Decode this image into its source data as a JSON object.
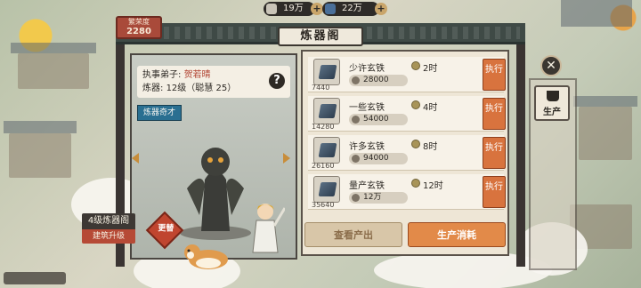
{
  "resources": [
    {
      "value": "19万",
      "icon": "silver-ingot-icon",
      "color": "#c9c4b8"
    },
    {
      "value": "22万",
      "icon": "ore-icon",
      "color": "#4a6f99"
    }
  ],
  "header": {
    "title": "炼器阁",
    "badge_label": "繁荣度",
    "badge_value": "2280"
  },
  "info": {
    "disciple_label": "执事弟子:",
    "disciple_name": "贺若晴",
    "forge_label": "炼器:",
    "forge_value": "12级（聪慧 25）"
  },
  "tag_label": "炼器奇才",
  "change_label": "更替",
  "building": {
    "level_label": "4级炼器阁",
    "upgrade_label": "建筑升级"
  },
  "items": [
    {
      "name": "少许玄铁",
      "qty": "7440",
      "cost": "28000",
      "time": "2时",
      "action": "执行"
    },
    {
      "name": "一些玄铁",
      "qty": "14280",
      "cost": "54000",
      "time": "4时",
      "action": "执行"
    },
    {
      "name": "许多玄铁",
      "qty": "26160",
      "cost": "94000",
      "time": "8时",
      "action": "执行"
    },
    {
      "name": "量产玄铁",
      "qty": "35640",
      "cost": "12万",
      "time": "12时",
      "action": "执行"
    }
  ],
  "tabs": {
    "view_output": "查看产出",
    "production_cost": "生产消耗"
  },
  "side": {
    "production_label": "生产"
  },
  "colors": {
    "accent": "#d8733e",
    "badge": "#a94a3a",
    "tag": "#2a6f91",
    "roof": "#3f4a46"
  }
}
